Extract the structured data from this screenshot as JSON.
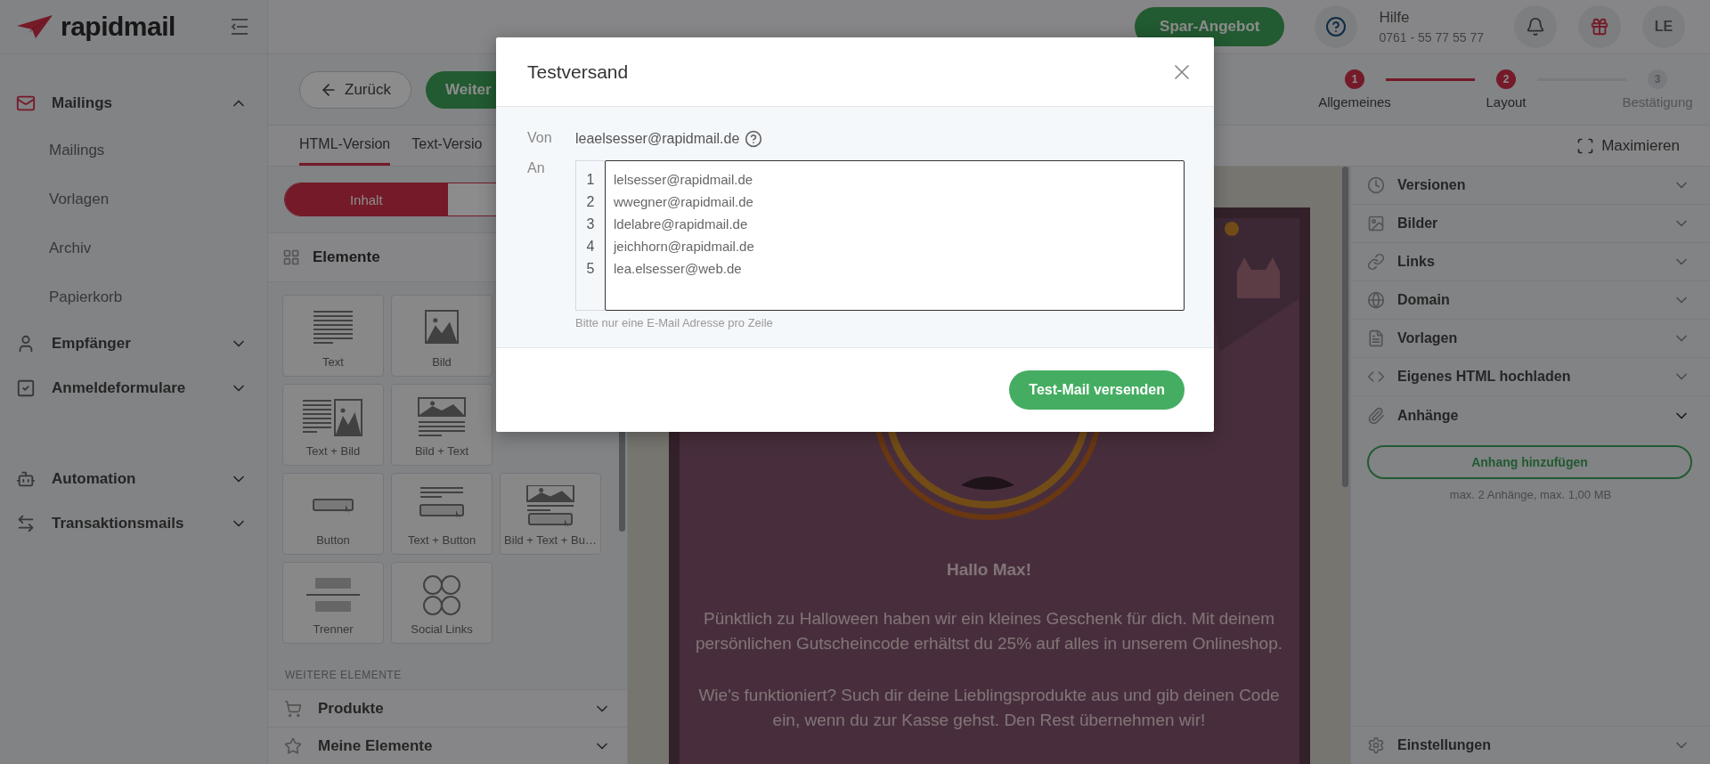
{
  "logo": {
    "text": "rapidmail"
  },
  "sidebar": {
    "groups": [
      [
        {
          "label": "Mailings",
          "expanded": true,
          "active": true,
          "children": [
            {
              "label": "Mailings"
            },
            {
              "label": "Vorlagen"
            },
            {
              "label": "Archiv"
            },
            {
              "label": "Papierkorb"
            }
          ]
        },
        {
          "label": "Empfänger",
          "expanded": false,
          "active": false
        },
        {
          "label": "Anmeldeformulare",
          "expanded": false,
          "active": false
        }
      ],
      [
        {
          "label": "Automation",
          "expanded": false,
          "active": false
        },
        {
          "label": "Transaktionsmails",
          "expanded": false,
          "active": false
        }
      ]
    ]
  },
  "topbar": {
    "offer_button": "Spar-Angebot",
    "help_title": "Hilfe",
    "help_phone": "0761 - 55 77 55 77",
    "avatar": "LE"
  },
  "toolbar": {
    "back_button": "Zurück",
    "next_button": "Weiter"
  },
  "steps": [
    {
      "number": "1",
      "label": "Allgemeines",
      "reached": true
    },
    {
      "number": "2",
      "label": "Layout",
      "reached": true
    },
    {
      "number": "3",
      "label": "Bestätigung",
      "reached": false
    }
  ],
  "tabs": [
    {
      "label": "HTML-Version",
      "selected": true
    },
    {
      "label": "Text-Versio",
      "selected": false
    }
  ],
  "maximize_button": "Maximieren",
  "segments": [
    {
      "label": "Inhalt",
      "selected": true
    }
  ],
  "elements": {
    "title": "Elemente",
    "tile_rows": [
      [
        {
          "kind": "text",
          "label": "Text"
        },
        {
          "kind": "image",
          "label": "Bild"
        }
      ],
      [
        {
          "kind": "text-image",
          "label": "Text + Bild"
        },
        {
          "kind": "image-text",
          "label": "Bild + Text"
        }
      ],
      [
        {
          "kind": "button",
          "label": "Button"
        },
        {
          "kind": "text-button",
          "label": "Text + Button"
        },
        {
          "kind": "image-text-button",
          "label": "Bild + Text + Bu…"
        }
      ],
      [
        {
          "kind": "divider",
          "label": "Trenner"
        },
        {
          "kind": "social",
          "label": "Social Links"
        }
      ]
    ],
    "more_title": "WEITERE ELEMENTE"
  },
  "left_accordions": [
    {
      "label": "Produkte",
      "expanded": false
    },
    {
      "label": "Meine Elemente",
      "expanded": false
    }
  ],
  "email": {
    "greeting": "Hallo Max!",
    "paragraphs": [
      "Pünktlich zu Halloween haben wir ein kleines Geschenk für dich. Mit deinem persönlichen Gutscheincode erhältst du 25% auf alles in unserem Onlineshop.",
      "Wie's funktioniert? Such dir deine Lieblingsprodukte aus und gib deinen Code ein, wenn du zur Kasse gehst. Den Rest übernehmen wir!"
    ]
  },
  "right_panel": {
    "sections": [
      {
        "label": "Versionen",
        "expanded": false
      },
      {
        "label": "Bilder",
        "expanded": false
      },
      {
        "label": "Links",
        "expanded": false
      },
      {
        "label": "Domain",
        "expanded": false
      },
      {
        "label": "Vorlagen",
        "expanded": false
      },
      {
        "label": "Eigenes HTML hochladen",
        "expanded": false
      },
      {
        "label": "Anhänge",
        "expanded": true,
        "button": "Anhang hinzufügen",
        "note": "max. 2 Anhänge, max. 1,00 MB"
      }
    ],
    "footer_section": {
      "label": "Einstellungen",
      "expanded": false
    }
  },
  "modal": {
    "title": "Testversand",
    "from_label": "Von",
    "from_value": "leaelsesser@rapidmail.de",
    "to_label": "An",
    "recipients": [
      {
        "number": "1",
        "email": "lelsesser@rapidmail.de"
      },
      {
        "number": "2",
        "email": "wwegner@rapidmail.de"
      },
      {
        "number": "3",
        "email": "ldelabre@rapidmail.de"
      },
      {
        "number": "4",
        "email": "jeichhorn@rapidmail.de"
      },
      {
        "number": "5",
        "email": "lea.elsesser@web.de"
      }
    ],
    "hint": "Bitte nur eine E-Mail Adresse pro Zeile",
    "send_button": "Test-Mail versenden"
  }
}
